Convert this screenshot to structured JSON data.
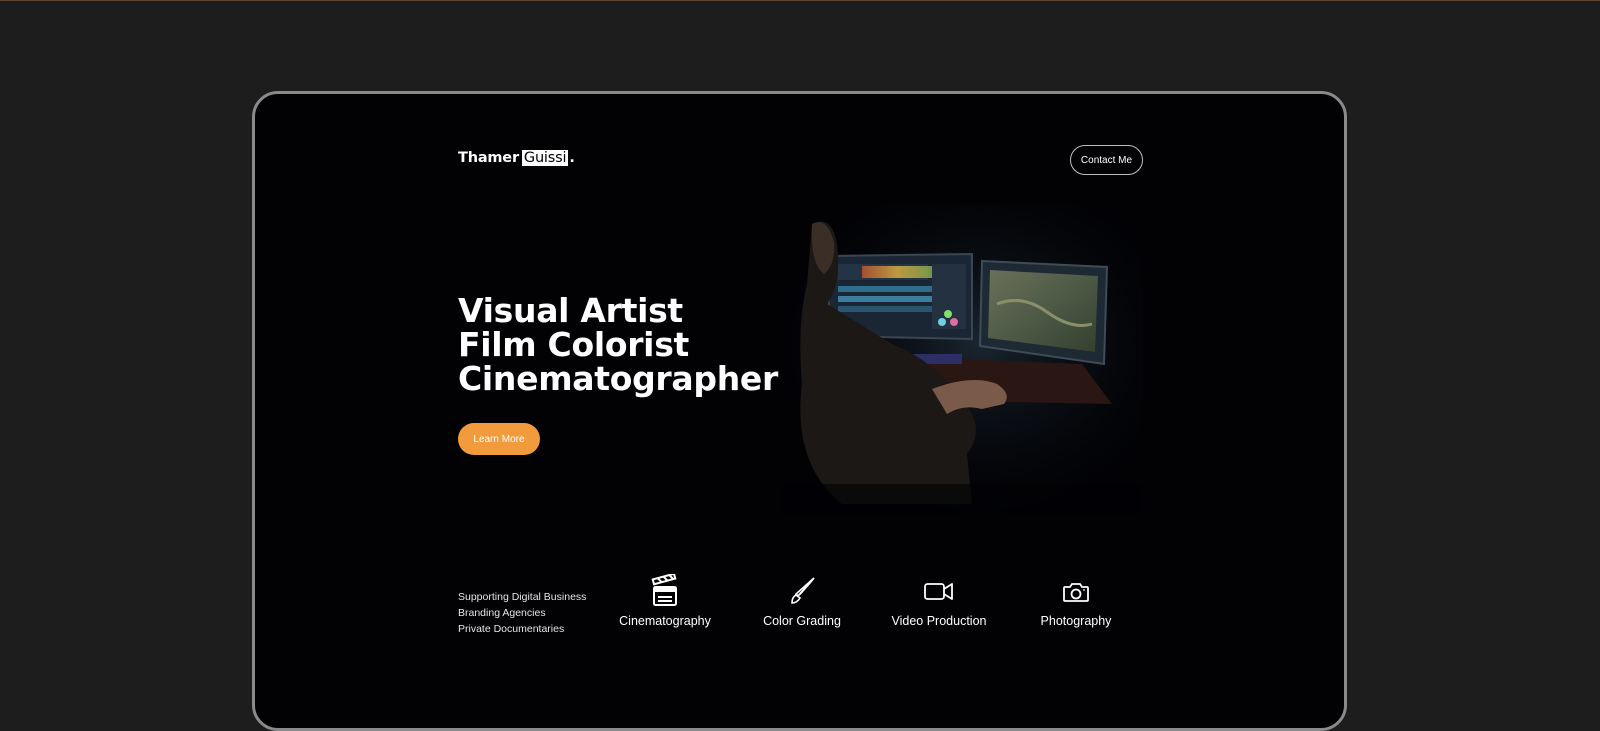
{
  "header": {
    "logo_first": "Thamer",
    "logo_highlight": "Guissi",
    "logo_dot": ".",
    "contact_label": "Contact Me"
  },
  "hero": {
    "line1": "Visual Artist",
    "line2": "Film Colorist",
    "line3": "Cinematographer",
    "cta_label": "Learn More",
    "cta_color": "#f29b3d"
  },
  "services": {
    "intro": [
      "Supporting Digital Business",
      "Branding Agencies",
      "Private Documentaries"
    ],
    "items": [
      {
        "label": "Cinematography",
        "icon": "clapperboard-icon"
      },
      {
        "label": "Color Grading",
        "icon": "brush-icon"
      },
      {
        "label": "Video Production",
        "icon": "video-camera-icon"
      },
      {
        "label": "Photography",
        "icon": "camera-icon"
      }
    ]
  }
}
